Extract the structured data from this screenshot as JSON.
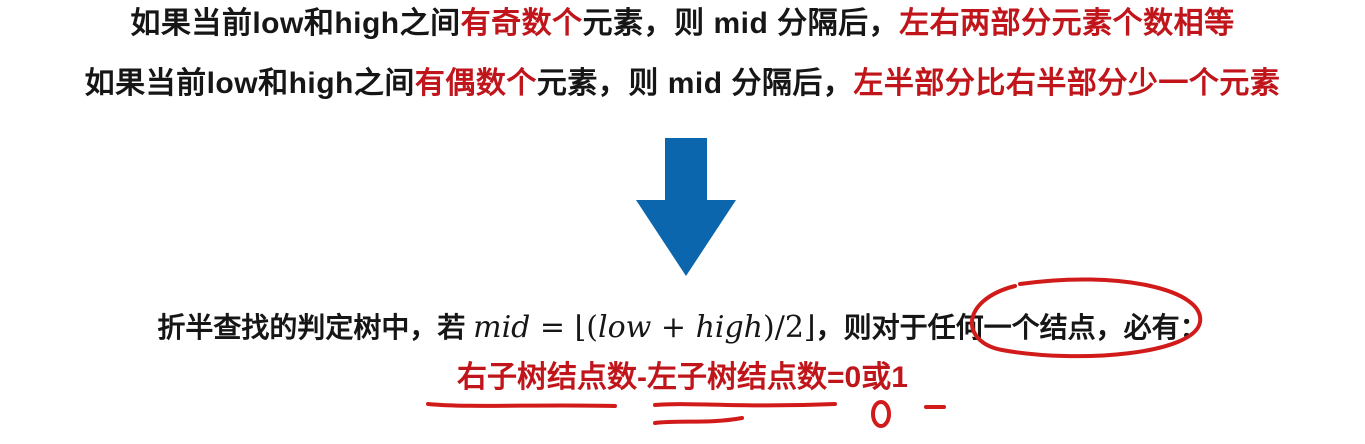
{
  "line1": {
    "part1": "如果当前low和high之间",
    "part2_red": "有奇数个",
    "part3": "元素，则 mid 分隔后，",
    "part4_red": "左右两部分元素个数相等"
  },
  "line2": {
    "part1": "如果当前low和high之间",
    "part2_red": "有偶数个",
    "part3": "元素，则 mid 分隔后，",
    "part4_red": "左半部分比右半部分少一个元素"
  },
  "arrow": {
    "icon": "down-arrow-icon",
    "color": "#0b66ad"
  },
  "line3": {
    "prefix": "折半查找的判定树中，若 ",
    "formula_mid": "mid",
    "formula_eq": " = ⌊(",
    "formula_low": "low",
    "formula_plus": " + ",
    "formula_high": "high",
    "formula_end": ")/2⌋",
    "suffix": "，则对于任何一个结点，必有："
  },
  "line4": {
    "text_red": "右子树结点数-左子树结点数=0或1"
  },
  "colors": {
    "text": "#161616",
    "emphasis_red": "#c0161b",
    "arrow_blue": "#0b66ad",
    "annotation_red": "#d11a1a"
  }
}
